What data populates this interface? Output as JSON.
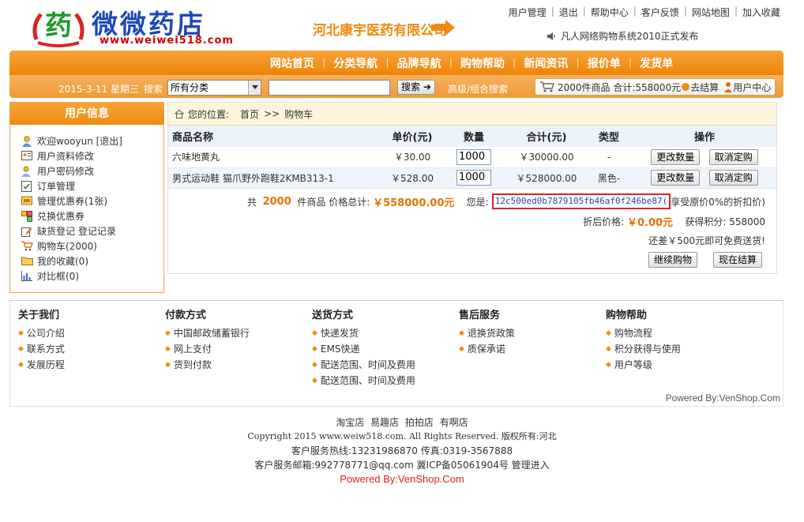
{
  "header": {
    "logo_glyph": "药",
    "logo_text": "微微药店",
    "logo_url": "www.weiwei518.com",
    "company": "河北康宇医药有限公司",
    "toplinks": [
      "用户管理",
      "退出",
      "帮助中心",
      "客户反馈",
      "网站地图",
      "加入收藏"
    ],
    "notice": "凡人网络购物系统2010正式发布"
  },
  "nav": {
    "items": [
      "网站首页",
      "分类导航",
      "品牌导航",
      "购物帮助",
      "新闻资讯",
      "报价单",
      "发货单"
    ],
    "date": "2015-3-11",
    "weekday": "星期三",
    "search_label": "搜索",
    "category_select": "所有分类",
    "search_button": "搜索",
    "advanced": "高级/组合搜索",
    "cart_summary": "2000件商品 合计:558000元",
    "checkout": "去结算",
    "user_center": "用户中心"
  },
  "sidebar": {
    "title": "用户信息",
    "welcome": "欢迎wooyun [退出]",
    "items": [
      "用户资料修改",
      "用户密码修改",
      "订单管理",
      "管理优惠券(1张)",
      "兑换优惠券",
      "缺货登记 登记记录",
      "购物车(2000)",
      "我的收藏(0)",
      "对比框(0)"
    ]
  },
  "breadcrumb": {
    "label": "您的位置:",
    "home": "首页",
    "sep": ">>",
    "current": "购物车"
  },
  "cart": {
    "headers": [
      "商品名称",
      "单价(元)",
      "数量",
      "合计(元)",
      "类型",
      "操作"
    ],
    "rows": [
      {
        "name": "六味地黄丸",
        "price": "￥30.00",
        "qty": "1000",
        "total": "￥30000.00",
        "type": "-",
        "btn1": "更改数量",
        "btn2": "取消定购"
      },
      {
        "name": "男式运动鞋 猫爪野外跑鞋2KMB313-1",
        "price": "￥528.00",
        "qty": "1000",
        "total": "￥528000.00",
        "type": "黑色-",
        "btn1": "更改数量",
        "btn2": "取消定购"
      }
    ],
    "sum_prefix": "共",
    "sum_count": "2000",
    "sum_mid": "件商品 价格总计:",
    "sum_total": "￥558000.00元",
    "you_are": "您是:",
    "coupon": "12c500ed0b7879105fb46af0f246be87(",
    "discount_note": "享受原价0%的折扣价)",
    "discount_label": "折后价格:",
    "discount_price": "￥0.00元",
    "points_label": "获得积分:",
    "points": "558000",
    "ship_note": "还差￥500元即可免费送货!",
    "continue_btn": "继续购物",
    "checkout_btn": "现在结算"
  },
  "help": {
    "columns": [
      {
        "title": "关于我们",
        "items": [
          "公司介绍",
          "联系方式",
          "发展历程"
        ]
      },
      {
        "title": "付款方式",
        "items": [
          "中国邮政储蓄银行",
          "网上支付",
          "货到付款"
        ]
      },
      {
        "title": "送货方式",
        "items": [
          "快递发货",
          "EMS快递",
          "配送范围、时间及费用",
          "配送范围、时间及费用"
        ]
      },
      {
        "title": "售后服务",
        "items": [
          "退换货政策",
          "质保承诺"
        ]
      },
      {
        "title": "购物帮助",
        "items": [
          "购物流程",
          "积分获得与使用",
          "用户等级"
        ]
      }
    ],
    "powered": "Powered By:VenShop.Com"
  },
  "bottom": {
    "links": [
      "淘宝店",
      "易趣店",
      "拍拍店",
      "有啊店"
    ],
    "copyright": "Copyright 2015 www.weiw518.com. All Rights Reserved. 版权所有:河北",
    "hotline": "客户服务热线:13231986870 传真:0319-3567888",
    "email": "客户服务邮箱:992778771@qq.com 冀ICP备05061904号 管理进入",
    "powered": "Powered By:VenShop.Com"
  },
  "colors": {
    "orange": "#f08a10",
    "brand_blue": "#1d49b8",
    "alert_red": "#e02020"
  }
}
